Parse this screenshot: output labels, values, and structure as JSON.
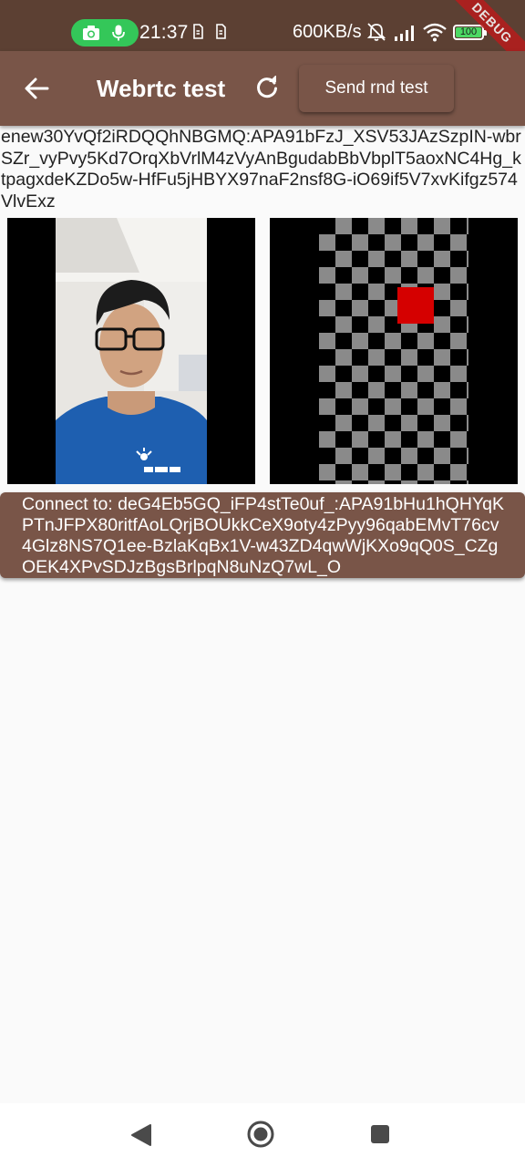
{
  "status_bar": {
    "time": "21:37",
    "network_speed": "600KB/s",
    "battery_level": "100",
    "debug_banner": "DEBUG",
    "icons": [
      "camera-icon",
      "microphone-icon",
      "sim-icon",
      "sim-icon",
      "notifications-off-icon",
      "signal-icon",
      "wifi-icon",
      "battery-icon"
    ]
  },
  "app_bar": {
    "title": "Webrtc test",
    "send_button_label": "Send rnd test",
    "icons": [
      "back-arrow-icon",
      "refresh-icon"
    ]
  },
  "main": {
    "local_token": "enew30YvQf2iRDQQhNBGMQ:APA91bFzJ_XSV53JAzSzpIN-wbrSZr_vyPvy5Kd7OrqXbVrlM4zVyAnBgudabBbVbplT5aoxNC4Hg_ktpagxdeKZDo5w-HfFu5jHBYX97naF2nsf8G-iO69if5V7xvKifgz574VlvExz",
    "local_video": "local-camera-feed",
    "remote_video": "remote-test-pattern",
    "connect_button_label": "Connect to: deG4Eb5GQ_iFP4stTe0uf_:APA91bHu1hQHYqKPTnJFPX80ritfAoLQrjBOUkkCeX9oty4zPyy96qabEMvT76cv4Glz8NS7Q1ee-BzlaKqBx1V-w43ZD4qwWjKXo9qQ0S_CZgOEK4XPvSDJzBgsBrlpqN8uNzQ7wL_O"
  },
  "nav_bar": {
    "icons": [
      "nav-back-icon",
      "nav-home-icon",
      "nav-recents-icon"
    ]
  },
  "colors": {
    "app_bar": "#795548",
    "status_bar": "#5c4033",
    "background": "#fafafa",
    "pill": "#34c759",
    "battery": "#4cd964",
    "remote_square": "#d50000"
  }
}
